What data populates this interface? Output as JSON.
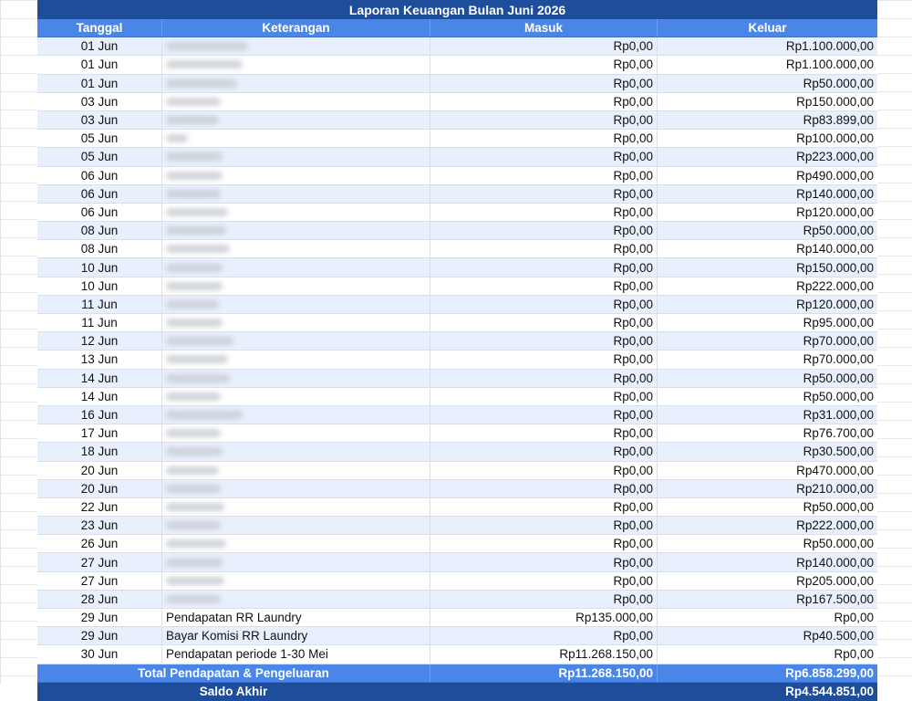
{
  "report": {
    "title": "Laporan Keuangan Bulan Juni 2026",
    "headers": {
      "tanggal": "Tanggal",
      "keterangan": "Keterangan",
      "masuk": "Masuk",
      "keluar": "Keluar"
    },
    "rows": [
      {
        "tanggal": "01 Jun",
        "keterangan": "",
        "masuk": "Rp0,00",
        "keluar": "Rp1.100.000,00"
      },
      {
        "tanggal": "01 Jun",
        "keterangan": "",
        "masuk": "Rp0,00",
        "keluar": "Rp1.100.000,00"
      },
      {
        "tanggal": "01 Jun",
        "keterangan": "",
        "masuk": "Rp0,00",
        "keluar": "Rp50.000,00"
      },
      {
        "tanggal": "03 Jun",
        "keterangan": "",
        "masuk": "Rp0,00",
        "keluar": "Rp150.000,00"
      },
      {
        "tanggal": "03 Jun",
        "keterangan": "",
        "masuk": "Rp0,00",
        "keluar": "Rp83.899,00"
      },
      {
        "tanggal": "05 Jun",
        "keterangan": "",
        "masuk": "Rp0,00",
        "keluar": "Rp100.000,00"
      },
      {
        "tanggal": "05 Jun",
        "keterangan": "",
        "masuk": "Rp0,00",
        "keluar": "Rp223.000,00"
      },
      {
        "tanggal": "06 Jun",
        "keterangan": "",
        "masuk": "Rp0,00",
        "keluar": "Rp490.000,00"
      },
      {
        "tanggal": "06 Jun",
        "keterangan": "",
        "masuk": "Rp0,00",
        "keluar": "Rp140.000,00"
      },
      {
        "tanggal": "06 Jun",
        "keterangan": "",
        "masuk": "Rp0,00",
        "keluar": "Rp120.000,00"
      },
      {
        "tanggal": "08 Jun",
        "keterangan": "",
        "masuk": "Rp0,00",
        "keluar": "Rp50.000,00"
      },
      {
        "tanggal": "08 Jun",
        "keterangan": "",
        "masuk": "Rp0,00",
        "keluar": "Rp140.000,00"
      },
      {
        "tanggal": "10 Jun",
        "keterangan": "",
        "masuk": "Rp0,00",
        "keluar": "Rp150.000,00"
      },
      {
        "tanggal": "10 Jun",
        "keterangan": "",
        "masuk": "Rp0,00",
        "keluar": "Rp222.000,00"
      },
      {
        "tanggal": "11 Jun",
        "keterangan": "",
        "masuk": "Rp0,00",
        "keluar": "Rp120.000,00"
      },
      {
        "tanggal": "11 Jun",
        "keterangan": "",
        "masuk": "Rp0,00",
        "keluar": "Rp95.000,00"
      },
      {
        "tanggal": "12 Jun",
        "keterangan": "",
        "masuk": "Rp0,00",
        "keluar": "Rp70.000,00"
      },
      {
        "tanggal": "13 Jun",
        "keterangan": "",
        "masuk": "Rp0,00",
        "keluar": "Rp70.000,00"
      },
      {
        "tanggal": "14 Jun",
        "keterangan": "",
        "masuk": "Rp0,00",
        "keluar": "Rp50.000,00"
      },
      {
        "tanggal": "14 Jun",
        "keterangan": "",
        "masuk": "Rp0,00",
        "keluar": "Rp50.000,00"
      },
      {
        "tanggal": "16 Jun",
        "keterangan": "",
        "masuk": "Rp0,00",
        "keluar": "Rp31.000,00"
      },
      {
        "tanggal": "17 Jun",
        "keterangan": "",
        "masuk": "Rp0,00",
        "keluar": "Rp76.700,00"
      },
      {
        "tanggal": "18 Jun",
        "keterangan": "",
        "masuk": "Rp0,00",
        "keluar": "Rp30.500,00"
      },
      {
        "tanggal": "20 Jun",
        "keterangan": "",
        "masuk": "Rp0,00",
        "keluar": "Rp470.000,00"
      },
      {
        "tanggal": "20 Jun",
        "keterangan": "",
        "masuk": "Rp0,00",
        "keluar": "Rp210.000,00"
      },
      {
        "tanggal": "22 Jun",
        "keterangan": "",
        "masuk": "Rp0,00",
        "keluar": "Rp50.000,00"
      },
      {
        "tanggal": "23 Jun",
        "keterangan": "",
        "masuk": "Rp0,00",
        "keluar": "Rp222.000,00"
      },
      {
        "tanggal": "26 Jun",
        "keterangan": "",
        "masuk": "Rp0,00",
        "keluar": "Rp50.000,00"
      },
      {
        "tanggal": "27 Jun",
        "keterangan": "",
        "masuk": "Rp0,00",
        "keluar": "Rp140.000,00"
      },
      {
        "tanggal": "27 Jun",
        "keterangan": "",
        "masuk": "Rp0,00",
        "keluar": "Rp205.000,00"
      },
      {
        "tanggal": "28 Jun",
        "keterangan": "",
        "masuk": "Rp0,00",
        "keluar": "Rp167.500,00"
      },
      {
        "tanggal": "29 Jun",
        "keterangan": "Pendapatan RR Laundry",
        "masuk": "Rp135.000,00",
        "keluar": "Rp0,00"
      },
      {
        "tanggal": "29 Jun",
        "keterangan": "Bayar Komisi RR Laundry",
        "masuk": "Rp0,00",
        "keluar": "Rp40.500,00"
      },
      {
        "tanggal": "30 Jun",
        "keterangan": "Pendapatan periode 1-30 Mei",
        "masuk": "Rp11.268.150,00",
        "keluar": "Rp0,00"
      }
    ],
    "total": {
      "label": "Total Pendapatan & Pengeluaran",
      "masuk": "Rp11.268.150,00",
      "keluar": "Rp6.858.299,00"
    },
    "saldo": {
      "label": "Saldo Akhir",
      "value": "Rp4.544.851,00"
    }
  },
  "colors": {
    "title_bg": "#1e4d9b",
    "header_bg": "#4a86e8",
    "band_bg": "#e8f0fd"
  }
}
